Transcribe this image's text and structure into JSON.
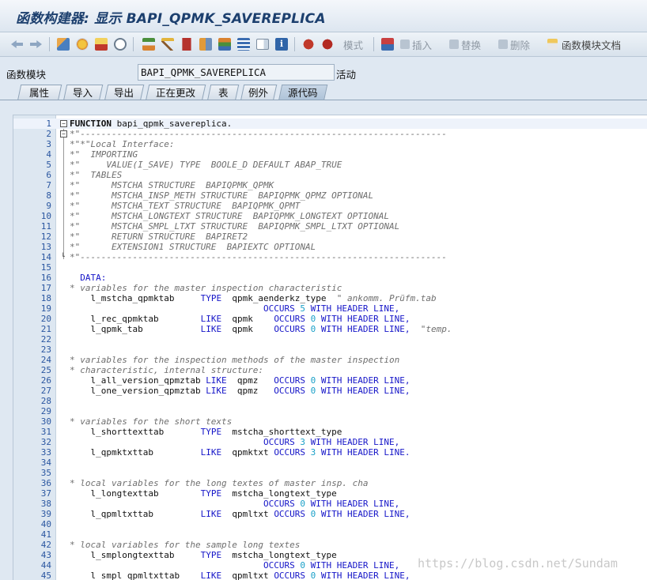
{
  "window": {
    "title": "函数构建器: 显示 BAPI_QPMK_SAVEREPLICA"
  },
  "toolbar": {
    "mode_label": "模式",
    "insert_label": "插入",
    "replace_label": "替换",
    "delete_label": "删除",
    "doc_label": "函数模块文档"
  },
  "function_module": {
    "label": "函数模块",
    "value": "BAPI_QPMK_SAVEREPLICA",
    "status": "活动"
  },
  "tabs": [
    {
      "label": "属性"
    },
    {
      "label": "导入"
    },
    {
      "label": "导出"
    },
    {
      "label": "正在更改"
    },
    {
      "label": "表"
    },
    {
      "label": "例外"
    },
    {
      "label": "源代码"
    }
  ],
  "active_tab": "源代码",
  "code": [
    {
      "n": "1",
      "t": "FUNCTION bapi_qpmk_savereplica.",
      "k": "func"
    },
    {
      "n": "2",
      "t": "*\"----------------------------------------------------------------------",
      "k": "com"
    },
    {
      "n": "3",
      "t": "*\"*\"Local Interface:",
      "k": "com"
    },
    {
      "n": "4",
      "t": "*\"  IMPORTING",
      "k": "com"
    },
    {
      "n": "5",
      "t": "*\"     VALUE(I_SAVE) TYPE  BOOLE_D DEFAULT ABAP_TRUE",
      "k": "com"
    },
    {
      "n": "6",
      "t": "*\"  TABLES",
      "k": "com"
    },
    {
      "n": "7",
      "t": "*\"      MSTCHA STRUCTURE  BAPIQPMK_QPMK",
      "k": "com"
    },
    {
      "n": "8",
      "t": "*\"      MSTCHA_INSP_METH STRUCTURE  BAPIQPMK_QPMZ OPTIONAL",
      "k": "com"
    },
    {
      "n": "9",
      "t": "*\"      MSTCHA_TEXT STRUCTURE  BAPIQPMK_QPMT",
      "k": "com"
    },
    {
      "n": "10",
      "t": "*\"      MSTCHA_LONGTEXT STRUCTURE  BAPIQPMK_LONGTEXT OPTIONAL",
      "k": "com"
    },
    {
      "n": "11",
      "t": "*\"      MSTCHA_SMPL_LTXT STRUCTURE  BAPIQPMK_SMPL_LTXT OPTIONAL",
      "k": "com"
    },
    {
      "n": "12",
      "t": "*\"      RETURN STRUCTURE  BAPIRET2",
      "k": "com"
    },
    {
      "n": "13",
      "t": "*\"      EXTENSION1 STRUCTURE  BAPIEXTC OPTIONAL",
      "k": "com"
    },
    {
      "n": "14",
      "t": "*\"----------------------------------------------------------------------",
      "k": "com"
    },
    {
      "n": "15",
      "t": "",
      "k": "blank"
    },
    {
      "n": "16",
      "t": "  DATA:",
      "k": "kw"
    },
    {
      "n": "17",
      "t": "* variables for the master inspection characteristic",
      "k": "com"
    },
    {
      "n": "18",
      "p": [
        "    l_mstcha_qpmktab     ",
        "TYPE",
        "  qpmk_aenderkz_type  ",
        "\" ankomm. Prüfm.tab"
      ],
      "k": "mixcom"
    },
    {
      "n": "19",
      "p": [
        "                                     ",
        "OCCURS ",
        "5",
        " WITH HEADER LINE,"
      ],
      "k": "occ"
    },
    {
      "n": "20",
      "p": [
        "    l_rec_qpmktab        ",
        "LIKE",
        "  qpmk    ",
        "OCCURS ",
        "0",
        " WITH HEADER LINE,"
      ],
      "k": "decl"
    },
    {
      "n": "21",
      "p": [
        "    l_qpmk_tab           ",
        "LIKE",
        "  qpmk    ",
        "OCCURS ",
        "0",
        " WITH HEADER LINE,",
        "  \"temp."
      ],
      "k": "declcom"
    },
    {
      "n": "22",
      "t": "",
      "k": "blank"
    },
    {
      "n": "23",
      "t": "",
      "k": "blank"
    },
    {
      "n": "24",
      "t": "* variables for the inspection methods of the master inspection",
      "k": "com"
    },
    {
      "n": "25",
      "t": "* characteristic, internal structure:",
      "k": "com"
    },
    {
      "n": "26",
      "p": [
        "    l_all_version_qpmztab ",
        "LIKE",
        "  qpmz   ",
        "OCCURS ",
        "0",
        " WITH HEADER LINE,"
      ],
      "k": "decl"
    },
    {
      "n": "27",
      "p": [
        "    l_one_version_qpmztab ",
        "LIKE",
        "  qpmz   ",
        "OCCURS ",
        "0",
        " WITH HEADER LINE,"
      ],
      "k": "decl"
    },
    {
      "n": "28",
      "t": "",
      "k": "blank"
    },
    {
      "n": "29",
      "t": "",
      "k": "blank"
    },
    {
      "n": "30",
      "t": "* variables for the short texts",
      "k": "com"
    },
    {
      "n": "31",
      "p": [
        "    l_shorttexttab       ",
        "TYPE",
        "  mstcha_shorttext_type"
      ],
      "k": "type"
    },
    {
      "n": "32",
      "p": [
        "                                     ",
        "OCCURS ",
        "3",
        " WITH HEADER LINE,"
      ],
      "k": "occ"
    },
    {
      "n": "33",
      "p": [
        "    l_qpmktxttab         ",
        "LIKE",
        "  qpmktxt ",
        "OCCURS ",
        "3",
        " WITH HEADER LINE."
      ],
      "k": "decl"
    },
    {
      "n": "34",
      "t": "",
      "k": "blank"
    },
    {
      "n": "35",
      "t": "",
      "k": "blank"
    },
    {
      "n": "36",
      "t": "* local variables for the long textes of master insp. cha",
      "k": "com"
    },
    {
      "n": "37",
      "p": [
        "    l_longtexttab        ",
        "TYPE",
        "  mstcha_longtext_type"
      ],
      "k": "type"
    },
    {
      "n": "38",
      "p": [
        "                                     ",
        "OCCURS ",
        "0",
        " WITH HEADER LINE,"
      ],
      "k": "occ"
    },
    {
      "n": "39",
      "p": [
        "    l_qpmltxttab         ",
        "LIKE",
        "  qpmltxt ",
        "OCCURS ",
        "0",
        " WITH HEADER LINE,"
      ],
      "k": "decl"
    },
    {
      "n": "40",
      "t": "",
      "k": "blank"
    },
    {
      "n": "41",
      "t": "",
      "k": "blank"
    },
    {
      "n": "42",
      "t": "* local variables for the sample long textes",
      "k": "com"
    },
    {
      "n": "43",
      "p": [
        "    l_smplongtexttab     ",
        "TYPE",
        "  mstcha_longtext_type"
      ],
      "k": "type"
    },
    {
      "n": "44",
      "p": [
        "                                     ",
        "OCCURS ",
        "0",
        " WITH HEADER LINE,"
      ],
      "k": "occ"
    },
    {
      "n": "45",
      "p": [
        "    l_smpl_qpmltxttab    ",
        "LIKE",
        "  qpmltxt ",
        "OCCURS ",
        "0",
        " WITH HEADER LINE,"
      ],
      "k": "decl"
    }
  ],
  "watermark": "https://blog.csdn.net/Sundam"
}
